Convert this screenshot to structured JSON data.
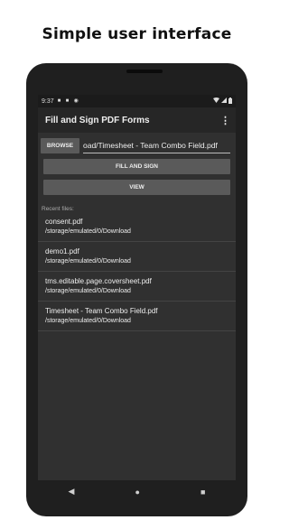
{
  "headline": "Simple user interface",
  "status_bar": {
    "time": "9:37"
  },
  "app_bar": {
    "title": "Fill and Sign PDF Forms",
    "menu_icon": "more-vert-icon"
  },
  "browse": {
    "button_label": "BROWSE",
    "file_path": "oad/Timesheet - Team Combo Field.pdf"
  },
  "actions": {
    "fill_sign_label": "FILL AND SIGN",
    "view_label": "VIEW"
  },
  "recent": {
    "label": "Recent files:",
    "files": [
      {
        "name": "consent.pdf",
        "path": "/storage/emulated/0/Download"
      },
      {
        "name": "demo1.pdf",
        "path": "/storage/emulated/0/Download"
      },
      {
        "name": "tms.editable.page.coversheet.pdf",
        "path": "/storage/emulated/0/Download"
      },
      {
        "name": "Timesheet - Team Combo Field.pdf",
        "path": "/storage/emulated/0/Download"
      }
    ]
  },
  "nav_bar": {
    "back_icon": "back-icon",
    "home_icon": "home-icon",
    "recents_icon": "recents-icon"
  }
}
